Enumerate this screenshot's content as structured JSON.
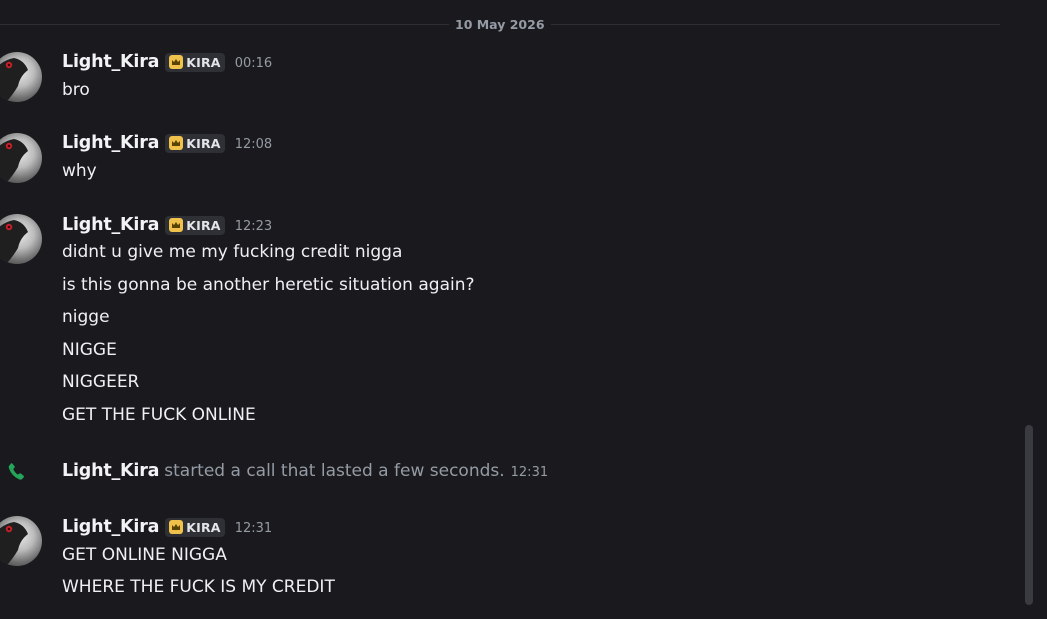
{
  "date_divider": "10 May 2026",
  "messages": [
    {
      "username": "Light_Kira",
      "tag": "KIRA",
      "time": "00:16",
      "lines": [
        "bro"
      ]
    },
    {
      "username": "Light_Kira",
      "tag": "KIRA",
      "time": "12:08",
      "lines": [
        "why"
      ]
    },
    {
      "username": "Light_Kira",
      "tag": "KIRA",
      "time": "12:23",
      "lines": [
        "didnt u give me my fucking credit nigga",
        "is this gonna be another heretic situation again?",
        "nigge",
        "NIGGE",
        "NIGGEER",
        "GET THE FUCK ONLINE"
      ]
    },
    {
      "username": "Light_Kira",
      "tag": "KIRA",
      "time": "12:31",
      "lines": [
        "GET ONLINE NIGGA",
        "WHERE THE FUCK IS MY CREDIT"
      ]
    }
  ],
  "call_event": {
    "username": "Light_Kira",
    "text": "started a call that lasted a few seconds.",
    "time": "12:31",
    "icon": "phone-icon"
  },
  "colors": {
    "background": "#1a1a1e",
    "tag_icon": "#f0c24b",
    "call_icon": "#23a55a"
  }
}
